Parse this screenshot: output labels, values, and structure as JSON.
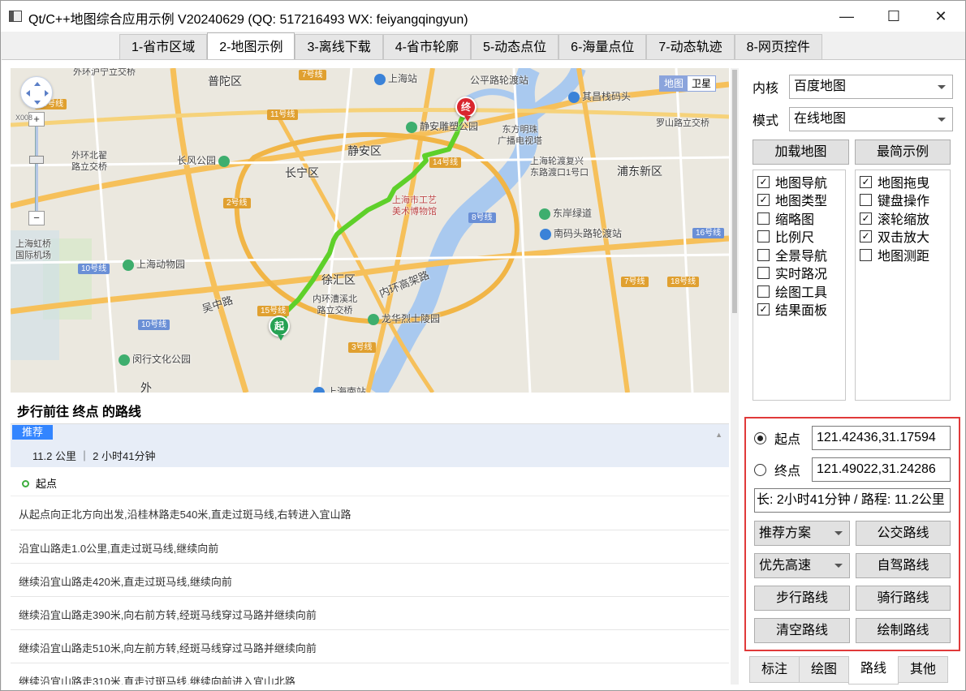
{
  "window": {
    "title": "Qt/C++地图综合应用示例 V20240629 (QQ: 517216493 WX: feiyangqingyun)",
    "minimize": "—",
    "maximize": "☐",
    "close": "✕"
  },
  "tabs": [
    "1-省市区域",
    "2-地图示例",
    "3-离线下载",
    "4-省市轮廓",
    "5-动态点位",
    "6-海量点位",
    "7-动态轨迹",
    "8-网页控件"
  ],
  "active_tab": "2-地图示例",
  "map": {
    "type_map": "地图",
    "type_satellite": "卫星",
    "zoom_in": "+",
    "zoom_out": "−",
    "scale_label": "X008",
    "start_marker": "起",
    "end_marker": "终",
    "labels": {
      "putuo": "普陀区",
      "jingan": "静安区",
      "changning": "长宁区",
      "xuhui": "徐汇区",
      "pudong": "浦东新区",
      "huangpu_note": "外环沪宁立交桥",
      "waihuan_beidi": "外环北翟\n路立交桥",
      "changfeng": "长风公园",
      "shanghai_station": "上海站",
      "gongping": "公平路轮渡站",
      "qichang": "其昌栈码头",
      "jingan_park": "静安雕塑公园",
      "oriental_pearl": "东方明珠\n广播电视塔",
      "shanghai_ferry": "上海轮渡复兴\n东路渡口1号口",
      "luoshan": "罗山路立交桥",
      "arts_museum": "上海市工艺\n美术博物馆",
      "dongchan": "东岸绿道",
      "nanmatou": "南码头路轮渡站",
      "hongqiao": "上海虹桥\n国际机场",
      "zoo": "上海动物园",
      "wuzhong": "吴中路",
      "neihuan": "内环高架路",
      "caoxi": "内环漕溪北\n路立交桥",
      "longhua": "龙华烈士陵园",
      "minhang_park": "闵行文化公园",
      "wai": "外",
      "shanghai_south": "上海南站"
    },
    "line_badges": {
      "l7a": "7号线",
      "l15a": "15号线",
      "l11": "11号线",
      "l14": "14号线",
      "l2": "2号线",
      "l8": "8号线",
      "l10a": "10号线",
      "l10b": "10号线",
      "l15b": "15号线",
      "l3": "3号线",
      "l7b": "7号线",
      "l18": "18号线",
      "l16": "16号线"
    }
  },
  "route": {
    "title": "步行前往 终点 的路线",
    "badge": "推荐",
    "summary": "11.2 公里 ｜ 2 小时41分钟",
    "start": "起点",
    "steps": [
      "从起点向正北方向出发,沿桂林路走540米,直走过斑马线,右转进入宜山路",
      "沿宜山路走1.0公里,直走过斑马线,继续向前",
      "继续沿宜山路走420米,直走过斑马线,继续向前",
      "继续沿宜山路走390米,向右前方转,经斑马线穿过马路并继续向前",
      "继续沿宜山路走510米,向左前方转,经斑马线穿过马路并继续向前",
      "继续沿宜山路走310米,直走过斑马线,继续向前进入宜山北路"
    ]
  },
  "settings": {
    "core_label": "内核",
    "core_value": "百度地图",
    "mode_label": "模式",
    "mode_value": "在线地图",
    "load_map": "加载地图",
    "simple_demo": "最简示例",
    "checks_left": [
      {
        "label": "地图导航",
        "checked": true
      },
      {
        "label": "地图类型",
        "checked": true
      },
      {
        "label": "缩略图",
        "checked": false
      },
      {
        "label": "比例尺",
        "checked": false
      },
      {
        "label": "全景导航",
        "checked": false
      },
      {
        "label": "实时路况",
        "checked": false
      },
      {
        "label": "绘图工具",
        "checked": false
      },
      {
        "label": "结果面板",
        "checked": true
      }
    ],
    "checks_right": [
      {
        "label": "地图拖曳",
        "checked": true
      },
      {
        "label": "键盘操作",
        "checked": false
      },
      {
        "label": "滚轮缩放",
        "checked": true
      },
      {
        "label": "双击放大",
        "checked": true
      },
      {
        "label": "地图测距",
        "checked": false
      }
    ]
  },
  "route_ctrl": {
    "start_label": "起点",
    "start_value": "121.42436,31.17594",
    "end_label": "终点",
    "end_value": "121.49022,31.24286",
    "result": "长: 2小时41分钟 / 路程: 11.2公里",
    "plan": "推荐方案",
    "bus": "公交路线",
    "priority": "优先高速",
    "drive": "自驾路线",
    "walk": "步行路线",
    "ride": "骑行路线",
    "clear": "清空路线",
    "draw": "绘制路线"
  },
  "bottom_tabs": [
    "标注",
    "绘图",
    "路线",
    "其他"
  ],
  "active_bottom_tab": "路线",
  "colors": {
    "route_green": "#5ed02a",
    "highlight_red": "#e03a3a",
    "recommend_blue": "#3385ff",
    "start_green": "#26a254",
    "end_red": "#d9262e"
  }
}
